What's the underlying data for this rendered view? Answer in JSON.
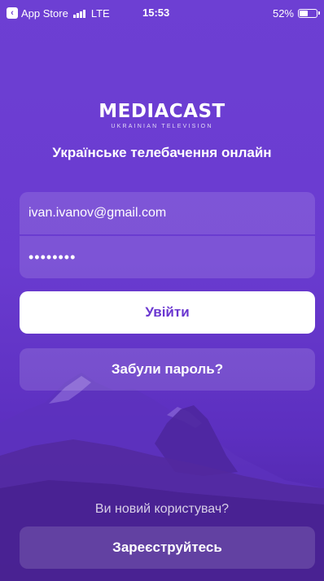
{
  "status_bar": {
    "back_app": "App Store",
    "network": "LTE",
    "time": "15:53",
    "battery": "52%",
    "battery_level": 0.52
  },
  "logo": {
    "title": "MEDIACAST",
    "subtitle": "UKRAINIAN TELEVISION"
  },
  "tagline": "Українське телебачення онлайн",
  "form": {
    "email_value": "ivan.ivanov@gmail.com",
    "password_value": "12345678"
  },
  "buttons": {
    "login": "Увійти",
    "forgot_password": "Забули пароль?",
    "register": "Зареєструйтесь"
  },
  "new_user_prompt": "Ви новий користувач?",
  "colors": {
    "background": "#6a3bd0",
    "accent": "#6a36d0",
    "primary_button": "#ffffff"
  },
  "icons": [
    "back-chevron-icon",
    "signal-icon",
    "battery-icon"
  ]
}
